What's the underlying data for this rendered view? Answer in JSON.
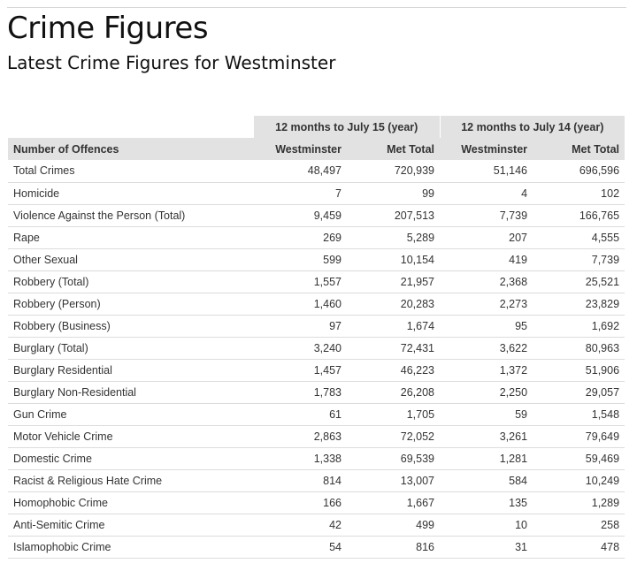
{
  "page": {
    "title": "Crime Figures",
    "subtitle": "Latest Crime Figures for Westminster"
  },
  "table": {
    "group_headers": [
      "12 months to July 15 (year)",
      "12 months to July 14 (year)"
    ],
    "column_headers": [
      "Number of Offences",
      "Westminster",
      "Met Total",
      "Westminster",
      "Met Total"
    ],
    "rows": [
      [
        "Total Crimes",
        "48,497",
        "720,939",
        "51,146",
        "696,596"
      ],
      [
        "Homicide",
        "7",
        "99",
        "4",
        "102"
      ],
      [
        "Violence Against the Person (Total)",
        "9,459",
        "207,513",
        "7,739",
        "166,765"
      ],
      [
        "Rape",
        "269",
        "5,289",
        "207",
        "4,555"
      ],
      [
        "Other Sexual",
        "599",
        "10,154",
        "419",
        "7,739"
      ],
      [
        "Robbery (Total)",
        "1,557",
        "21,957",
        "2,368",
        "25,521"
      ],
      [
        "Robbery (Person)",
        "1,460",
        "20,283",
        "2,273",
        "23,829"
      ],
      [
        "Robbery (Business)",
        "97",
        "1,674",
        "95",
        "1,692"
      ],
      [
        "Burglary (Total)",
        "3,240",
        "72,431",
        "3,622",
        "80,963"
      ],
      [
        "Burglary Residential",
        "1,457",
        "46,223",
        "1,372",
        "51,906"
      ],
      [
        "Burglary Non-Residential",
        "1,783",
        "26,208",
        "2,250",
        "29,057"
      ],
      [
        "Gun Crime",
        "61",
        "1,705",
        "59",
        "1,548"
      ],
      [
        "Motor Vehicle Crime",
        "2,863",
        "72,052",
        "3,261",
        "79,649"
      ],
      [
        "Domestic Crime",
        "1,338",
        "69,539",
        "1,281",
        "59,469"
      ],
      [
        "Racist & Religious Hate Crime",
        "814",
        "13,007",
        "584",
        "10,249"
      ],
      [
        "Homophobic Crime",
        "166",
        "1,667",
        "135",
        "1,289"
      ],
      [
        "Anti-Semitic Crime",
        "42",
        "499",
        "10",
        "258"
      ],
      [
        "Islamophobic Crime",
        "54",
        "816",
        "31",
        "478"
      ]
    ]
  }
}
